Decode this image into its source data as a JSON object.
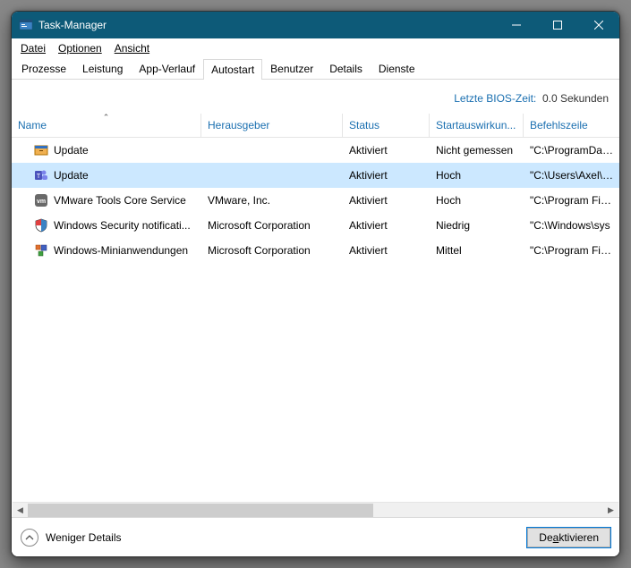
{
  "window": {
    "title": "Task-Manager"
  },
  "menu": {
    "file": "Datei",
    "options": "Optionen",
    "view": "Ansicht"
  },
  "tabs": {
    "processes": "Prozesse",
    "performance": "Leistung",
    "apphistory": "App-Verlauf",
    "startup": "Autostart",
    "users": "Benutzer",
    "details": "Details",
    "services": "Dienste"
  },
  "bios": {
    "label": "Letzte BIOS-Zeit:",
    "value": "0.0 Sekunden"
  },
  "columns": {
    "name": "Name",
    "publisher": "Herausgeber",
    "status": "Status",
    "impact": "Startauswirkun...",
    "cmdline": "Befehlszeile"
  },
  "rows": [
    {
      "icon": "installer",
      "name": "Update",
      "publisher": "",
      "status": "Aktiviert",
      "impact": "Nicht gemessen",
      "cmdline": "\"C:\\ProgramData\\"
    },
    {
      "icon": "teams",
      "name": "Update",
      "publisher": "",
      "status": "Aktiviert",
      "impact": "Hoch",
      "cmdline": "\"C:\\Users\\Axel\\Ap"
    },
    {
      "icon": "vm",
      "name": "VMware Tools Core Service",
      "publisher": "VMware, Inc.",
      "status": "Aktiviert",
      "impact": "Hoch",
      "cmdline": "\"C:\\Program Files"
    },
    {
      "icon": "shield",
      "name": "Windows Security notificati...",
      "publisher": "Microsoft Corporation",
      "status": "Aktiviert",
      "impact": "Niedrig",
      "cmdline": "\"C:\\Windows\\sys"
    },
    {
      "icon": "gadget",
      "name": "Windows-Minianwendungen",
      "publisher": "Microsoft Corporation",
      "status": "Aktiviert",
      "impact": "Mittel",
      "cmdline": "\"C:\\Program Files"
    }
  ],
  "footer": {
    "fewer": "Weniger Details",
    "action": "Deaktivieren"
  }
}
